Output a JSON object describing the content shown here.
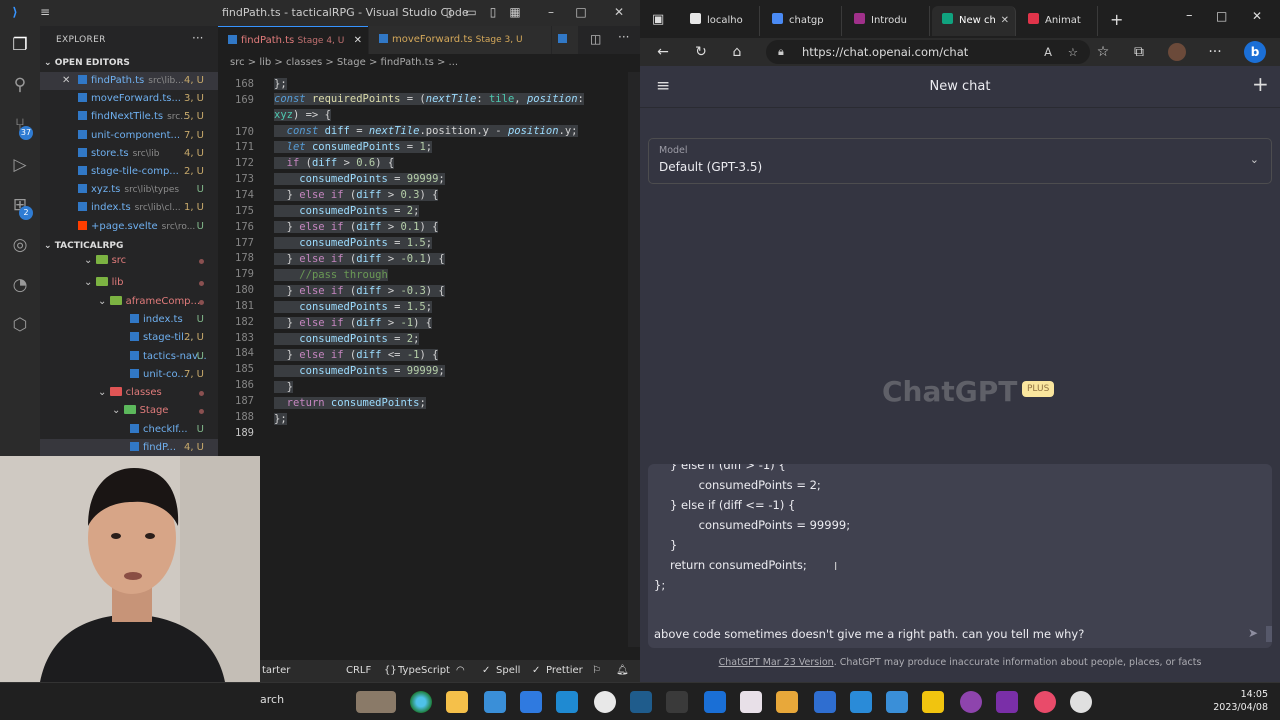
{
  "vscode": {
    "window_title": "findPath.ts - tacticalRPG - Visual Studio Code",
    "explorer_label": "EXPLORER",
    "open_editors_label": "OPEN EDITORS",
    "project_label": "TACTICALRPG",
    "open_editors": [
      {
        "name": "findPath.ts",
        "path": "src\\lib...",
        "status": "4, U"
      },
      {
        "name": "moveForward.ts...",
        "path": "",
        "status": "3, U"
      },
      {
        "name": "findNextTile.ts",
        "path": "src...",
        "status": "5, U"
      },
      {
        "name": "unit-component...",
        "path": "",
        "status": "7, U"
      },
      {
        "name": "store.ts",
        "path": "src\\lib",
        "status": "4, U"
      },
      {
        "name": "stage-tile-comp...",
        "path": "",
        "status": "2, U"
      },
      {
        "name": "xyz.ts",
        "path": "src\\lib\\types",
        "status": "U"
      },
      {
        "name": "index.ts",
        "path": "src\\lib\\cl...",
        "status": "1, U"
      },
      {
        "name": "+page.svelte",
        "path": "src\\ro...",
        "status": "U"
      }
    ],
    "tree": [
      {
        "name": "src",
        "status": ""
      },
      {
        "name": "lib",
        "status": ""
      },
      {
        "name": "aframeComp...",
        "status": ""
      },
      {
        "name": "index.ts",
        "status": "U"
      },
      {
        "name": "stage-til...",
        "status": "2, U"
      },
      {
        "name": "tactics-nav...",
        "status": "U"
      },
      {
        "name": "unit-co...",
        "status": "7, U"
      },
      {
        "name": "classes",
        "status": ""
      },
      {
        "name": "Stage",
        "status": ""
      },
      {
        "name": "checkIf...",
        "status": "U"
      },
      {
        "name": "findP...",
        "status": "4, U"
      }
    ],
    "tabs": [
      {
        "name": "findPath.ts",
        "detail": "Stage 4, U"
      },
      {
        "name": "moveForward.ts",
        "detail": "Stage 3, U"
      }
    ],
    "breadcrumb": "src > lib > classes > Stage > findPath.ts > ...",
    "line_numbers": [
      "168",
      "169",
      "",
      "170",
      "171",
      "172",
      "173",
      "174",
      "175",
      "176",
      "177",
      "178",
      "179",
      "180",
      "181",
      "182",
      "183",
      "184",
      "185",
      "186",
      "187",
      "188",
      "189"
    ],
    "statusbar": {
      "starter": "tarter",
      "eol": "CRLF",
      "lang": "TypeScript",
      "spell": "Spell",
      "prettier": "Prettier"
    }
  },
  "browser": {
    "tabs": [
      {
        "label": "localho",
        "color": "#e8e8e8"
      },
      {
        "label": "chatgp",
        "color": "#4a8af4"
      },
      {
        "label": "Introdu",
        "color": "#a0308a"
      },
      {
        "label": "New ch",
        "color": "#10a37f"
      },
      {
        "label": "Animat",
        "color": "#e0344a"
      }
    ],
    "url": "https://chat.openai.com/chat",
    "chat_title": "New chat",
    "model_label": "Model",
    "model_value": "Default (GPT-3.5)",
    "logo": "ChatGPT",
    "plus": "PLUS",
    "code_lines": [
      "} else if (diff > -1) {",
      "    consumedPoints = 2;",
      "} else if (diff <= -1) {",
      "    consumedPoints = 99999;",
      "}",
      "return consumedPoints;",
      "};"
    ],
    "question": "above code sometimes doesn't give me a right path. can you tell me why?",
    "footer_link": "ChatGPT Mar 23 Version",
    "footer_text": ". ChatGPT may produce inaccurate information about people, places, or facts"
  },
  "taskbar": {
    "search_label": "arch",
    "time": "14:05",
    "date": "2023/04/08"
  },
  "colors": {
    "vscode_bg": "#1e1e1e",
    "chat_bg": "#343541",
    "input_bg": "#40414f",
    "plus_badge": "#fae69e"
  }
}
